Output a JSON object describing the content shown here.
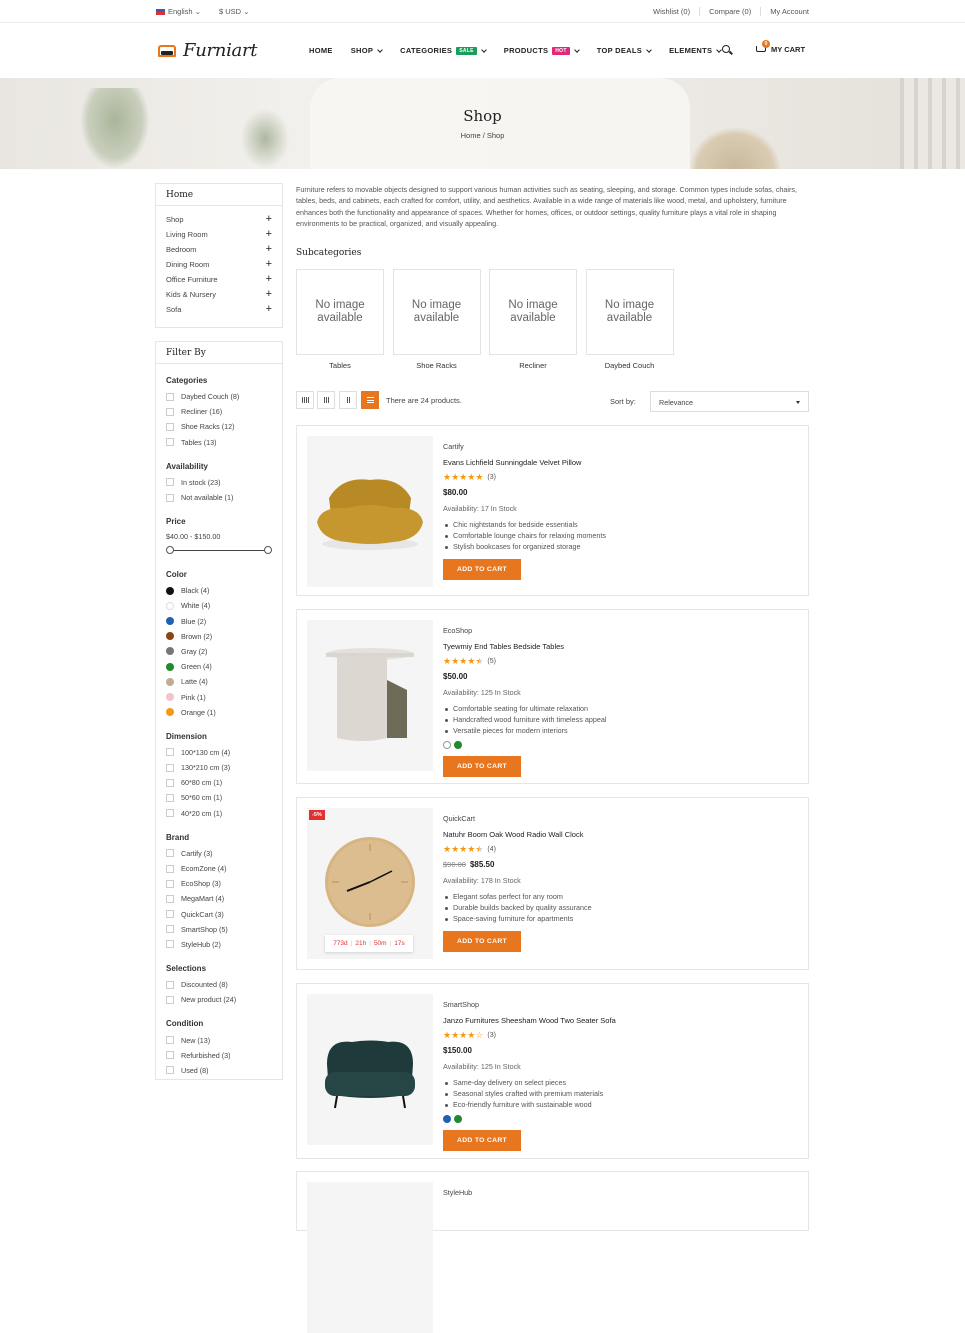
{
  "topbar": {
    "language": "English",
    "currency": "$ USD",
    "wishlist": "Wishlist (0)",
    "compare": "Compare (0)",
    "account": "My Account"
  },
  "header": {
    "logo": "Furniart",
    "nav": [
      {
        "label": "HOME",
        "tag": "",
        "tag_color": ""
      },
      {
        "label": "SHOP",
        "tag": "",
        "tag_color": "",
        "chevron": true
      },
      {
        "label": "CATEGORIES",
        "tag": "SALE",
        "tag_color": "#1a9e5b",
        "chevron": true
      },
      {
        "label": "PRODUCTS",
        "tag": "HOT",
        "tag_color": "#e0297a",
        "chevron": true
      },
      {
        "label": "TOP DEALS",
        "tag": "",
        "tag_color": "",
        "chevron": true
      },
      {
        "label": "ELEMENTS",
        "tag": "",
        "tag_color": "",
        "chevron": true
      }
    ],
    "cart_label": "MY CART",
    "cart_count": "0"
  },
  "hero": {
    "title": "Shop",
    "breadcrumb": "Home  /  Shop"
  },
  "sidebar": {
    "home_title": "Home",
    "categories": [
      "Shop",
      "Living Room",
      "Bedroom",
      "Dining Room",
      "Office Furniture",
      "Kids & Nursery",
      "Sofa"
    ],
    "filter_title": "Filter By",
    "groups": [
      {
        "title": "Categories",
        "type": "check",
        "items": [
          "Daybed Couch (8)",
          "Recliner (16)",
          "Shoe Racks (12)",
          "Tables (13)"
        ]
      },
      {
        "title": "Availability",
        "type": "check",
        "items": [
          "In stock (23)",
          "Not available (1)"
        ]
      },
      {
        "title": "Price",
        "type": "range",
        "value": "$40.00 - $150.00"
      },
      {
        "title": "Color",
        "type": "color",
        "items": [
          {
            "label": "Black (4)",
            "color": "#111111"
          },
          {
            "label": "White (4)",
            "color": "#ffffff"
          },
          {
            "label": "Blue (2)",
            "color": "#1f5fb5"
          },
          {
            "label": "Brown (2)",
            "color": "#8b4513"
          },
          {
            "label": "Gray (2)",
            "color": "#777777"
          },
          {
            "label": "Green (4)",
            "color": "#1f8a2e"
          },
          {
            "label": "Latte (4)",
            "color": "#c3aa92"
          },
          {
            "label": "Pink (1)",
            "color": "#f4c2c9"
          },
          {
            "label": "Orange (1)",
            "color": "#f39a12"
          }
        ]
      },
      {
        "title": "Dimension",
        "type": "check",
        "items": [
          "100*130 cm (4)",
          "130*210 cm (3)",
          "60*80 cm (1)",
          "50*60 cm (1)",
          "40*20 cm (1)"
        ]
      },
      {
        "title": "Brand",
        "type": "check",
        "items": [
          "Cartify (3)",
          "EcomZone (4)",
          "EcoShop (3)",
          "MegaMart (4)",
          "QuickCart (3)",
          "SmartShop (5)",
          "StyleHub (2)"
        ]
      },
      {
        "title": "Selections",
        "type": "check",
        "items": [
          "Discounted (8)",
          "New product (24)"
        ]
      },
      {
        "title": "Condition",
        "type": "check",
        "items": [
          "New (13)",
          "Refurbished (3)",
          "Used (8)"
        ]
      }
    ]
  },
  "main": {
    "description": "Furniture refers to movable objects designed to support various human activities such as seating, sleeping, and storage. Common types include sofas, chairs, tables, beds, and cabinets, each crafted for comfort, utility, and aesthetics. Available in a wide range of materials like wood, metal, and upholstery, furniture enhances both the functionality and appearance of spaces. Whether for homes, offices, or outdoor settings, quality furniture plays a vital role in shaping environments to be practical, organized, and visually appealing.",
    "subcategories_title": "Subcategories",
    "no_image": "No image available",
    "subcategories": [
      "Tables",
      "Shoe Racks",
      "Recliner",
      "Daybed Couch"
    ],
    "product_count": "There are 24 products.",
    "sort_label": "Sort by:",
    "sort_value": "Relevance"
  },
  "products": [
    {
      "brand": "Cartify",
      "name": "Evans Lichfield Sunningdale Velvet Pillow",
      "rating": 5,
      "reviews": "(3)",
      "old_price": "",
      "price": "$80.00",
      "availability": "Availability: 17 In Stock",
      "bullets": [
        "Chic nightstands for bedside essentials",
        "Comfortable lounge chairs for relaxing moments",
        "Stylish bookcases for organized storage"
      ],
      "colors": [],
      "discount": "",
      "timer": null,
      "button": "ADD TO CART"
    },
    {
      "brand": "EcoShop",
      "name": "Tyewmiy End Tables Bedside Tables",
      "rating": 4.5,
      "reviews": "(5)",
      "old_price": "",
      "price": "$50.00",
      "availability": "Availability: 125 In Stock",
      "bullets": [
        "Comfortable seating for ultimate relaxation",
        "Handcrafted wood furniture with timeless appeal",
        "Versatile pieces for modern interiors"
      ],
      "colors": [
        "#ffffff",
        "#1f8a2e"
      ],
      "discount": "",
      "timer": null,
      "button": "ADD TO CART"
    },
    {
      "brand": "QuickCart",
      "name": "Natuhr Boom Oak Wood Radio Wall Clock",
      "rating": 4.5,
      "reviews": "(4)",
      "old_price": "$90.00",
      "price": "$85.50",
      "availability": "Availability: 178 In Stock",
      "bullets": [
        "Elegant sofas perfect for any room",
        "Durable builds backed by quality assurance",
        "Space-saving furniture for apartments"
      ],
      "colors": [],
      "discount": "-5%",
      "timer": [
        "773d",
        "21h",
        "50m",
        "17s"
      ],
      "button": "ADD TO CART"
    },
    {
      "brand": "SmartShop",
      "name": "Janzo Furnitures Sheesham Wood Two Seater Sofa",
      "rating": 4,
      "reviews": "(3)",
      "old_price": "",
      "price": "$150.00",
      "availability": "Availability: 125 In Stock",
      "bullets": [
        "Same-day delivery on select pieces",
        "Seasonal styles crafted with premium materials",
        "Eco-friendly furniture with sustainable wood"
      ],
      "colors": [
        "#1f5fb5",
        "#1f8a2e"
      ],
      "discount": "",
      "timer": null,
      "button": "ADD TO CART"
    },
    {
      "brand": "StyleHub",
      "name": "",
      "rating": 0,
      "reviews": "",
      "old_price": "",
      "price": "",
      "availability": "",
      "bullets": [],
      "colors": [],
      "discount": "",
      "timer": null,
      "button": ""
    }
  ],
  "colors": {
    "accent": "#e8761e",
    "star": "#f39a12",
    "sale_tag": "#1a9e5b",
    "hot_tag": "#e0297a",
    "discount": "#e03030"
  }
}
